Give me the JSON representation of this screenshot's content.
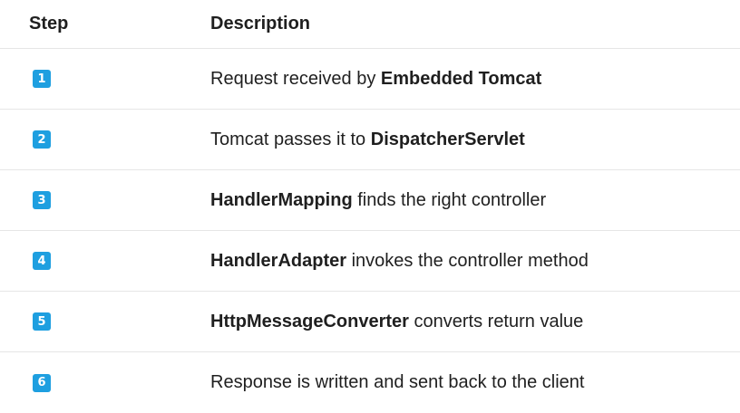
{
  "table": {
    "headers": {
      "step": "Step",
      "description": "Description"
    },
    "rows": [
      {
        "step": "1",
        "before": "Request received by ",
        "bold": "Embedded Tomcat",
        "after": ""
      },
      {
        "step": "2",
        "before": "Tomcat passes it to ",
        "bold": "DispatcherServlet",
        "after": ""
      },
      {
        "step": "3",
        "before": "",
        "bold": "HandlerMapping",
        "after": " finds the right controller"
      },
      {
        "step": "4",
        "before": "",
        "bold": "HandlerAdapter",
        "after": " invokes the controller method"
      },
      {
        "step": "5",
        "before": "",
        "bold": "HttpMessageConverter",
        "after": " converts return value"
      },
      {
        "step": "6",
        "before": "Response is written and sent back to the client",
        "bold": "",
        "after": ""
      }
    ]
  },
  "colors": {
    "badge": "#1e9fe0",
    "text": "#1f1f1f",
    "divider": "#e6e6e6"
  }
}
